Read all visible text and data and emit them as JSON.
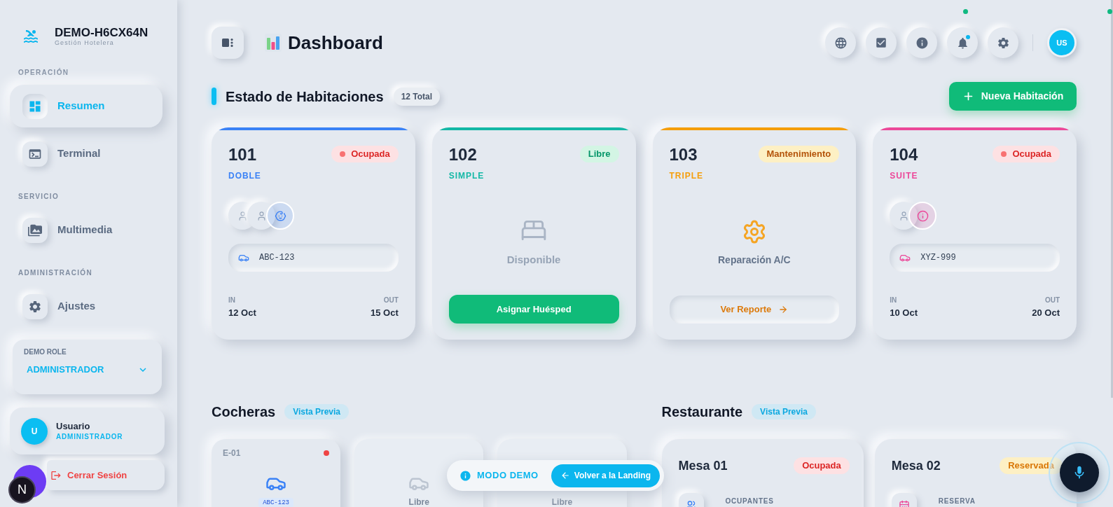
{
  "sidebar": {
    "brand": {
      "name": "DEMO-H6CX64N",
      "subtitle": "Gestión Hotelera"
    },
    "sections": [
      {
        "label": "OPERACIÓN",
        "items": [
          {
            "label": "Resumen",
            "selected": true
          },
          {
            "label": "Terminal",
            "selected": false
          }
        ]
      },
      {
        "label": "SERVICIO",
        "items": [
          {
            "label": "Multimedia",
            "selected": false
          }
        ]
      },
      {
        "label": "ADMINISTRACIÓN",
        "items": [
          {
            "label": "Ajustes",
            "selected": false
          }
        ]
      }
    ],
    "role_select": {
      "label": "DEMO ROLE",
      "value": "ADMINISTRADOR"
    },
    "user": {
      "initial": "U",
      "name": "Usuario",
      "role": "ADMINISTRADOR"
    },
    "logout": "Cerrar Sesión"
  },
  "header": {
    "title": "Dashboard",
    "notifications_unread": true,
    "avatar": "US"
  },
  "rooms_section": {
    "title": "Estado de Habitaciones",
    "count_badge": "12 Total",
    "add_button": "Nueva Habitación",
    "rooms": [
      {
        "number": "101",
        "type": "DOBLE",
        "color": "#3b82f6",
        "status": {
          "label": "Ocupada",
          "kind": "occupied"
        },
        "guests": [
          {
            "kind": "adult"
          },
          {
            "kind": "adult"
          },
          {
            "kind": "child"
          }
        ],
        "plate": "ABC-123",
        "check_in": {
          "label": "IN",
          "date": "12 Oct"
        },
        "check_out": {
          "label": "OUT",
          "date": "15 Oct"
        }
      },
      {
        "number": "102",
        "type": "SIMPLE",
        "color": "#14b8a6",
        "status": {
          "label": "Libre",
          "kind": "free"
        },
        "message": "Disponible",
        "button": "Asignar Huésped"
      },
      {
        "number": "103",
        "type": "TRIPLE",
        "color": "#f59e0b",
        "status": {
          "label": "Mantenimiento",
          "kind": "maintenance"
        },
        "message": "Reparación A/C",
        "button": "Ver Reporte"
      },
      {
        "number": "104",
        "type": "SUITE",
        "color": "#ec4899",
        "status": {
          "label": "Ocupada",
          "kind": "occupied"
        },
        "guests": [
          {
            "kind": "adult"
          },
          {
            "kind": "alert"
          }
        ],
        "plate": "XYZ-999",
        "check_in": {
          "label": "IN",
          "date": "10 Oct"
        },
        "check_out": {
          "label": "OUT",
          "date": "20 Oct"
        }
      }
    ]
  },
  "parking": {
    "title": "Cocheras",
    "badge": "Vista Previa",
    "spots": [
      {
        "label": "E-01",
        "occupied": true,
        "plate": "ABC-123",
        "car_icon": true
      },
      {
        "occupied": false,
        "status": "Libre",
        "car_icon": true
      },
      {
        "occupied": false,
        "status": "Libre",
        "car_icon": false
      }
    ]
  },
  "restaurant": {
    "title": "Restaurante",
    "badge": "Vista Previa",
    "tables": [
      {
        "name": "Mesa 01",
        "status": {
          "label": "Ocupada",
          "kind": "occupied"
        },
        "detail_label": "OCUPANTES"
      },
      {
        "name": "Mesa 02",
        "status": {
          "label": "Reservada",
          "kind": "reserved"
        },
        "detail_label": "RESERVA"
      }
    ]
  },
  "demo_banner": {
    "label": "MODO DEMO",
    "button": "Volver a la Landing"
  },
  "dev_indicator": {
    "label": "N"
  }
}
